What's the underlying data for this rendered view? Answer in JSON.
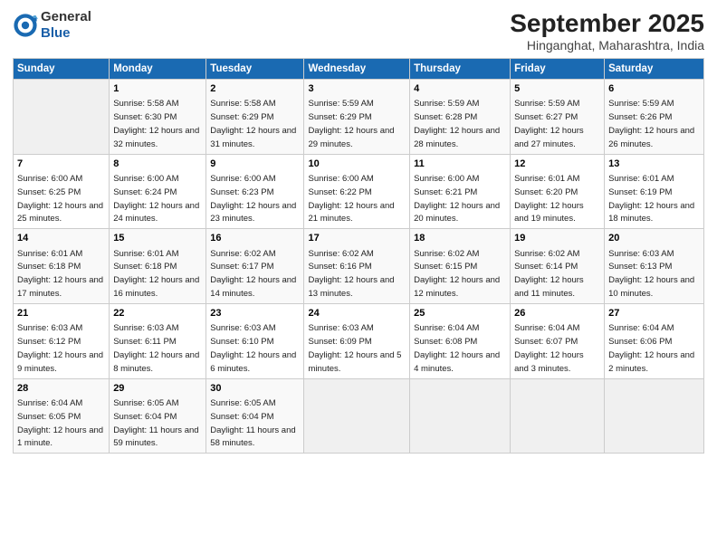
{
  "header": {
    "logo_general": "General",
    "logo_blue": "Blue",
    "main_title": "September 2025",
    "subtitle": "Hinganghat, Maharashtra, India"
  },
  "days_of_week": [
    "Sunday",
    "Monday",
    "Tuesday",
    "Wednesday",
    "Thursday",
    "Friday",
    "Saturday"
  ],
  "weeks": [
    [
      {
        "num": "",
        "sunrise": "",
        "sunset": "",
        "daylight": "",
        "empty": true
      },
      {
        "num": "1",
        "sunrise": "Sunrise: 5:58 AM",
        "sunset": "Sunset: 6:30 PM",
        "daylight": "Daylight: 12 hours and 32 minutes."
      },
      {
        "num": "2",
        "sunrise": "Sunrise: 5:58 AM",
        "sunset": "Sunset: 6:29 PM",
        "daylight": "Daylight: 12 hours and 31 minutes."
      },
      {
        "num": "3",
        "sunrise": "Sunrise: 5:59 AM",
        "sunset": "Sunset: 6:29 PM",
        "daylight": "Daylight: 12 hours and 29 minutes."
      },
      {
        "num": "4",
        "sunrise": "Sunrise: 5:59 AM",
        "sunset": "Sunset: 6:28 PM",
        "daylight": "Daylight: 12 hours and 28 minutes."
      },
      {
        "num": "5",
        "sunrise": "Sunrise: 5:59 AM",
        "sunset": "Sunset: 6:27 PM",
        "daylight": "Daylight: 12 hours and 27 minutes."
      },
      {
        "num": "6",
        "sunrise": "Sunrise: 5:59 AM",
        "sunset": "Sunset: 6:26 PM",
        "daylight": "Daylight: 12 hours and 26 minutes."
      }
    ],
    [
      {
        "num": "7",
        "sunrise": "Sunrise: 6:00 AM",
        "sunset": "Sunset: 6:25 PM",
        "daylight": "Daylight: 12 hours and 25 minutes."
      },
      {
        "num": "8",
        "sunrise": "Sunrise: 6:00 AM",
        "sunset": "Sunset: 6:24 PM",
        "daylight": "Daylight: 12 hours and 24 minutes."
      },
      {
        "num": "9",
        "sunrise": "Sunrise: 6:00 AM",
        "sunset": "Sunset: 6:23 PM",
        "daylight": "Daylight: 12 hours and 23 minutes."
      },
      {
        "num": "10",
        "sunrise": "Sunrise: 6:00 AM",
        "sunset": "Sunset: 6:22 PM",
        "daylight": "Daylight: 12 hours and 21 minutes."
      },
      {
        "num": "11",
        "sunrise": "Sunrise: 6:00 AM",
        "sunset": "Sunset: 6:21 PM",
        "daylight": "Daylight: 12 hours and 20 minutes."
      },
      {
        "num": "12",
        "sunrise": "Sunrise: 6:01 AM",
        "sunset": "Sunset: 6:20 PM",
        "daylight": "Daylight: 12 hours and 19 minutes."
      },
      {
        "num": "13",
        "sunrise": "Sunrise: 6:01 AM",
        "sunset": "Sunset: 6:19 PM",
        "daylight": "Daylight: 12 hours and 18 minutes."
      }
    ],
    [
      {
        "num": "14",
        "sunrise": "Sunrise: 6:01 AM",
        "sunset": "Sunset: 6:18 PM",
        "daylight": "Daylight: 12 hours and 17 minutes."
      },
      {
        "num": "15",
        "sunrise": "Sunrise: 6:01 AM",
        "sunset": "Sunset: 6:18 PM",
        "daylight": "Daylight: 12 hours and 16 minutes."
      },
      {
        "num": "16",
        "sunrise": "Sunrise: 6:02 AM",
        "sunset": "Sunset: 6:17 PM",
        "daylight": "Daylight: 12 hours and 14 minutes."
      },
      {
        "num": "17",
        "sunrise": "Sunrise: 6:02 AM",
        "sunset": "Sunset: 6:16 PM",
        "daylight": "Daylight: 12 hours and 13 minutes."
      },
      {
        "num": "18",
        "sunrise": "Sunrise: 6:02 AM",
        "sunset": "Sunset: 6:15 PM",
        "daylight": "Daylight: 12 hours and 12 minutes."
      },
      {
        "num": "19",
        "sunrise": "Sunrise: 6:02 AM",
        "sunset": "Sunset: 6:14 PM",
        "daylight": "Daylight: 12 hours and 11 minutes."
      },
      {
        "num": "20",
        "sunrise": "Sunrise: 6:03 AM",
        "sunset": "Sunset: 6:13 PM",
        "daylight": "Daylight: 12 hours and 10 minutes."
      }
    ],
    [
      {
        "num": "21",
        "sunrise": "Sunrise: 6:03 AM",
        "sunset": "Sunset: 6:12 PM",
        "daylight": "Daylight: 12 hours and 9 minutes."
      },
      {
        "num": "22",
        "sunrise": "Sunrise: 6:03 AM",
        "sunset": "Sunset: 6:11 PM",
        "daylight": "Daylight: 12 hours and 8 minutes."
      },
      {
        "num": "23",
        "sunrise": "Sunrise: 6:03 AM",
        "sunset": "Sunset: 6:10 PM",
        "daylight": "Daylight: 12 hours and 6 minutes."
      },
      {
        "num": "24",
        "sunrise": "Sunrise: 6:03 AM",
        "sunset": "Sunset: 6:09 PM",
        "daylight": "Daylight: 12 hours and 5 minutes."
      },
      {
        "num": "25",
        "sunrise": "Sunrise: 6:04 AM",
        "sunset": "Sunset: 6:08 PM",
        "daylight": "Daylight: 12 hours and 4 minutes."
      },
      {
        "num": "26",
        "sunrise": "Sunrise: 6:04 AM",
        "sunset": "Sunset: 6:07 PM",
        "daylight": "Daylight: 12 hours and 3 minutes."
      },
      {
        "num": "27",
        "sunrise": "Sunrise: 6:04 AM",
        "sunset": "Sunset: 6:06 PM",
        "daylight": "Daylight: 12 hours and 2 minutes."
      }
    ],
    [
      {
        "num": "28",
        "sunrise": "Sunrise: 6:04 AM",
        "sunset": "Sunset: 6:05 PM",
        "daylight": "Daylight: 12 hours and 1 minute."
      },
      {
        "num": "29",
        "sunrise": "Sunrise: 6:05 AM",
        "sunset": "Sunset: 6:04 PM",
        "daylight": "Daylight: 11 hours and 59 minutes."
      },
      {
        "num": "30",
        "sunrise": "Sunrise: 6:05 AM",
        "sunset": "Sunset: 6:04 PM",
        "daylight": "Daylight: 11 hours and 58 minutes."
      },
      {
        "num": "",
        "sunrise": "",
        "sunset": "",
        "daylight": "",
        "empty": true
      },
      {
        "num": "",
        "sunrise": "",
        "sunset": "",
        "daylight": "",
        "empty": true
      },
      {
        "num": "",
        "sunrise": "",
        "sunset": "",
        "daylight": "",
        "empty": true
      },
      {
        "num": "",
        "sunrise": "",
        "sunset": "",
        "daylight": "",
        "empty": true
      }
    ]
  ]
}
